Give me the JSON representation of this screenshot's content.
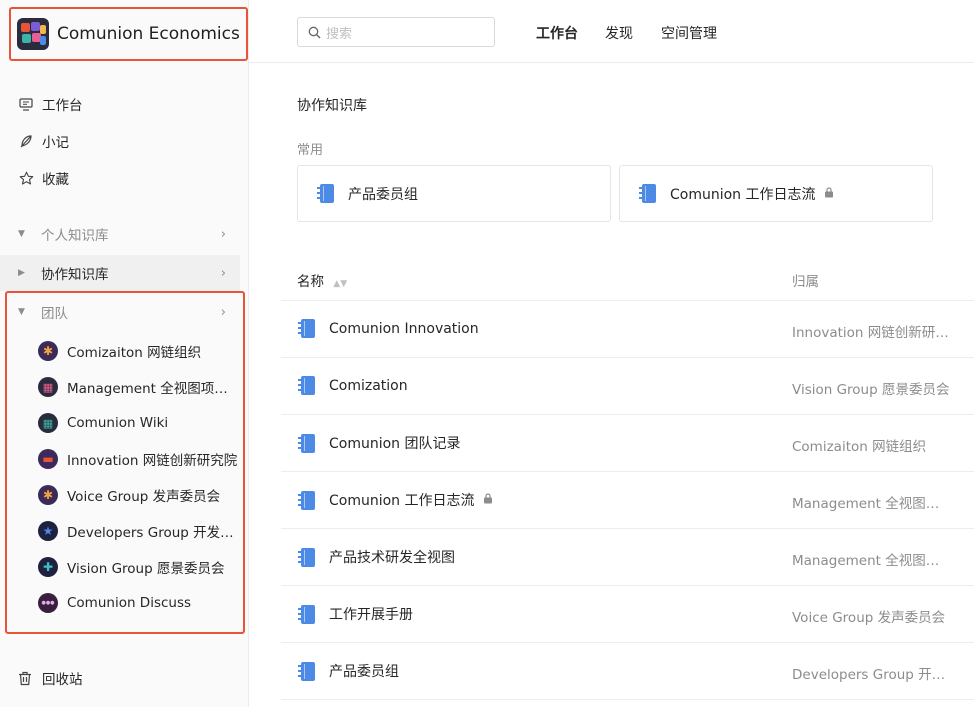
{
  "app": {
    "title": "Comunion Economics"
  },
  "sidebar": {
    "nav": [
      {
        "label": "工作台",
        "icon": "monitor-icon"
      },
      {
        "label": "小记",
        "icon": "feather-icon"
      },
      {
        "label": "收藏",
        "icon": "star-icon"
      }
    ],
    "sections": {
      "personal": "个人知识库",
      "collab": "协作知识库",
      "team": "团队"
    },
    "teams": [
      {
        "label": "Comizaiton 网链组织",
        "avatar_color": "#3b2a5a"
      },
      {
        "label": "Management 全视图项目...",
        "avatar_color": "#2a2b3d"
      },
      {
        "label": "Comunion Wiki",
        "avatar_color": "#2a2b3d"
      },
      {
        "label": "Innovation 网链创新研究院",
        "avatar_color": "#3b2a5a"
      },
      {
        "label": "Voice Group 发声委员会",
        "avatar_color": "#3b2a5a"
      },
      {
        "label": "Developers Group 开发者...",
        "avatar_color": "#1e2140"
      },
      {
        "label": "Vision Group 愿景委员会",
        "avatar_color": "#1e2140"
      },
      {
        "label": "Comunion Discuss",
        "avatar_color": "#3a1e3d"
      }
    ],
    "trash": "回收站"
  },
  "header": {
    "search_placeholder": "搜索",
    "tabs": [
      "工作台",
      "发现",
      "空间管理"
    ]
  },
  "main": {
    "title": "协作知识库",
    "common_label": "常用",
    "common_cards": [
      {
        "label": "产品委员组",
        "locked": false
      },
      {
        "label": "Comunion 工作日志流",
        "locked": true
      }
    ],
    "columns": {
      "name": "名称",
      "owner": "归属"
    },
    "rows": [
      {
        "name": "Comunion Innovation",
        "owner": "Innovation 网链创新研…",
        "locked": false
      },
      {
        "name": "Comization",
        "owner": "Vision Group 愿景委员会",
        "locked": false
      },
      {
        "name": "Comunion 团队记录",
        "owner": "Comizaiton 网链组织",
        "locked": false
      },
      {
        "name": "Comunion 工作日志流",
        "owner": "Management 全视图项…",
        "locked": true
      },
      {
        "name": "产品技术研发全视图",
        "owner": "Management 全视图项…",
        "locked": false
      },
      {
        "name": "工作开展手册",
        "owner": "Voice Group 发声委员会",
        "locked": false
      },
      {
        "name": "产品委员组",
        "owner": "Developers Group 开发…",
        "locked": false
      }
    ]
  },
  "colors": {
    "highlight_border": "#e8543a",
    "book_blue": "#4c8ae6"
  }
}
